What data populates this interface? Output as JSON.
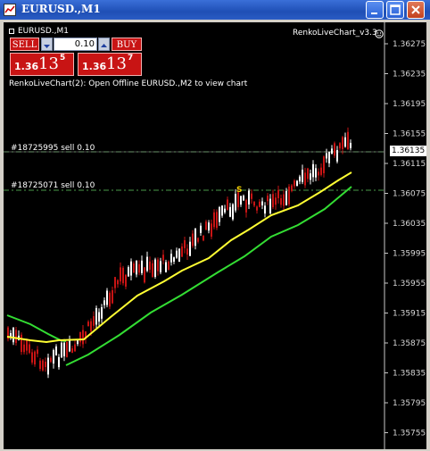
{
  "window": {
    "title": "EURUSD.,M1",
    "colors": {
      "titlebar": "#2a5cc4",
      "chart_bg": "#000000",
      "bull": "#ffffff",
      "bear": "#c81414",
      "ma_fast": "#ffff33",
      "ma_slow": "#33dd33"
    }
  },
  "chart": {
    "symbol_label": "EURUSD.,M1",
    "indicator_label": "RenkoLiveChart_v3.3",
    "info_text": "RenkoLiveChart(2): Open Offline EURUSD.,M2 to view chart",
    "price_axis": [
      "1.36275",
      "1.36235",
      "1.36195",
      "1.36155",
      "1.36115",
      "1.36075",
      "1.36035",
      "1.35995",
      "1.35955",
      "1.35915",
      "1.35875",
      "1.35835",
      "1.35795",
      "1.35755"
    ],
    "current_price": "1.36135",
    "signal_marker": "S"
  },
  "orders": [
    {
      "label": "#18725995 sell 0.10"
    },
    {
      "label": "#18725071 sell 0.10"
    }
  ],
  "trade_panel": {
    "sell_label": "SELL",
    "buy_label": "BUY",
    "lot_value": "0.10",
    "sell_quote": {
      "base": "1.36",
      "big": "13",
      "sup": "5"
    },
    "buy_quote": {
      "base": "1.36",
      "big": "13",
      "sup": "7"
    }
  }
}
